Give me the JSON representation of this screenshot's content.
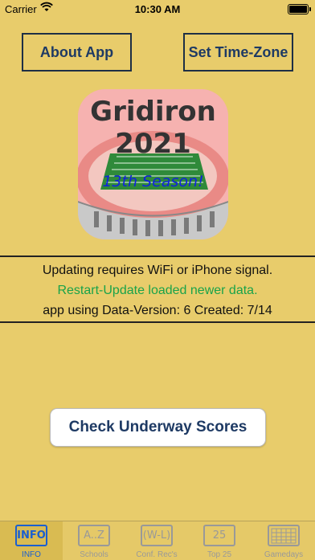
{
  "status_bar": {
    "carrier": "Carrier",
    "time": "10:30 AM"
  },
  "buttons": {
    "about": "About App",
    "timezone": "Set Time-Zone",
    "check_scores": "Check Underway Scores"
  },
  "app_icon": {
    "title_line1": "Gridiron",
    "title_line2": "2021",
    "tagline": "13th Season!"
  },
  "info": {
    "line1": "Updating requires WiFi or iPhone signal.",
    "line2": "Restart-Update loaded newer data.",
    "line3": "app using Data-Version: 6 Created: 7/14"
  },
  "tabs": [
    {
      "label": "INFO",
      "icon_text": "INFO",
      "icon": "info-icon",
      "active": true
    },
    {
      "label": "Schools",
      "icon_text": "A..Z",
      "icon": "az-icon",
      "active": false
    },
    {
      "label": "Conf. Rec's",
      "icon_text": "(W-L)",
      "icon": "wl-icon",
      "active": false
    },
    {
      "label": "Top 25",
      "icon_text": "25",
      "icon": "top25-icon",
      "active": false
    },
    {
      "label": "Gamedays",
      "icon_text": "",
      "icon": "calendar-icon",
      "active": false
    }
  ],
  "colors": {
    "background": "#e8cc6b",
    "button_text": "#1e3a64",
    "info_green": "#19a34a",
    "tab_active": "#1a5fd0"
  }
}
